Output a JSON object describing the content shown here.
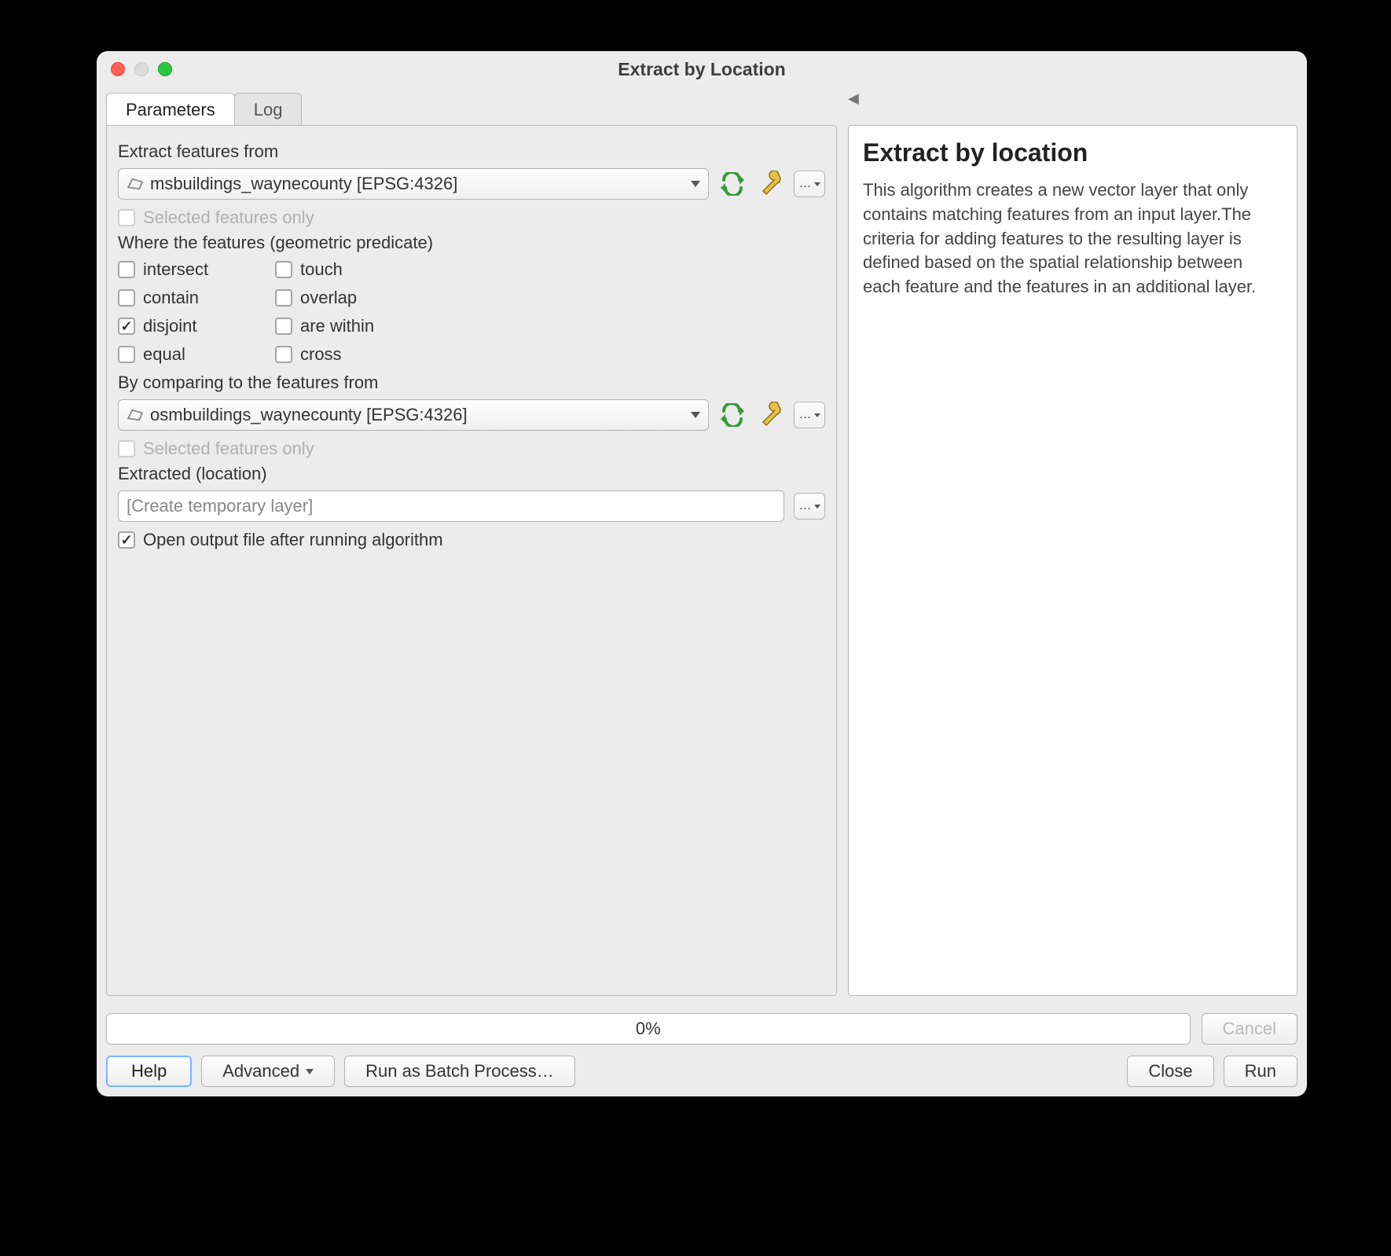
{
  "window": {
    "title": "Extract by Location"
  },
  "tabs": {
    "parameters": "Parameters",
    "log": "Log"
  },
  "params": {
    "extract_from_label": "Extract features from",
    "extract_from_value": "msbuildings_waynecounty [EPSG:4326]",
    "selected_only_label": "Selected features only",
    "predicate_label": "Where the features (geometric predicate)",
    "predicates": {
      "intersect": "intersect",
      "touch": "touch",
      "contain": "contain",
      "overlap": "overlap",
      "disjoint": "disjoint",
      "are_within": "are within",
      "equal": "equal",
      "cross": "cross"
    },
    "predicate_checked": {
      "disjoint": true
    },
    "compare_label": "By comparing to the features from",
    "compare_value": "osmbuildings_waynecounty [EPSG:4326]",
    "selected_only_label2": "Selected features only",
    "output_label": "Extracted (location)",
    "output_placeholder": "[Create temporary layer]",
    "open_output_label": "Open output file after running algorithm"
  },
  "help": {
    "title": "Extract by location",
    "body": "This algorithm creates a new vector layer that only contains matching features from an input layer.The criteria for adding features to the resulting layer is defined based on the spatial relationship between each feature and the features in an additional layer."
  },
  "progress": {
    "text": "0%"
  },
  "buttons": {
    "cancel": "Cancel",
    "help": "Help",
    "advanced": "Advanced",
    "batch": "Run as Batch Process…",
    "close": "Close",
    "run": "Run",
    "ellipsis": "…"
  }
}
